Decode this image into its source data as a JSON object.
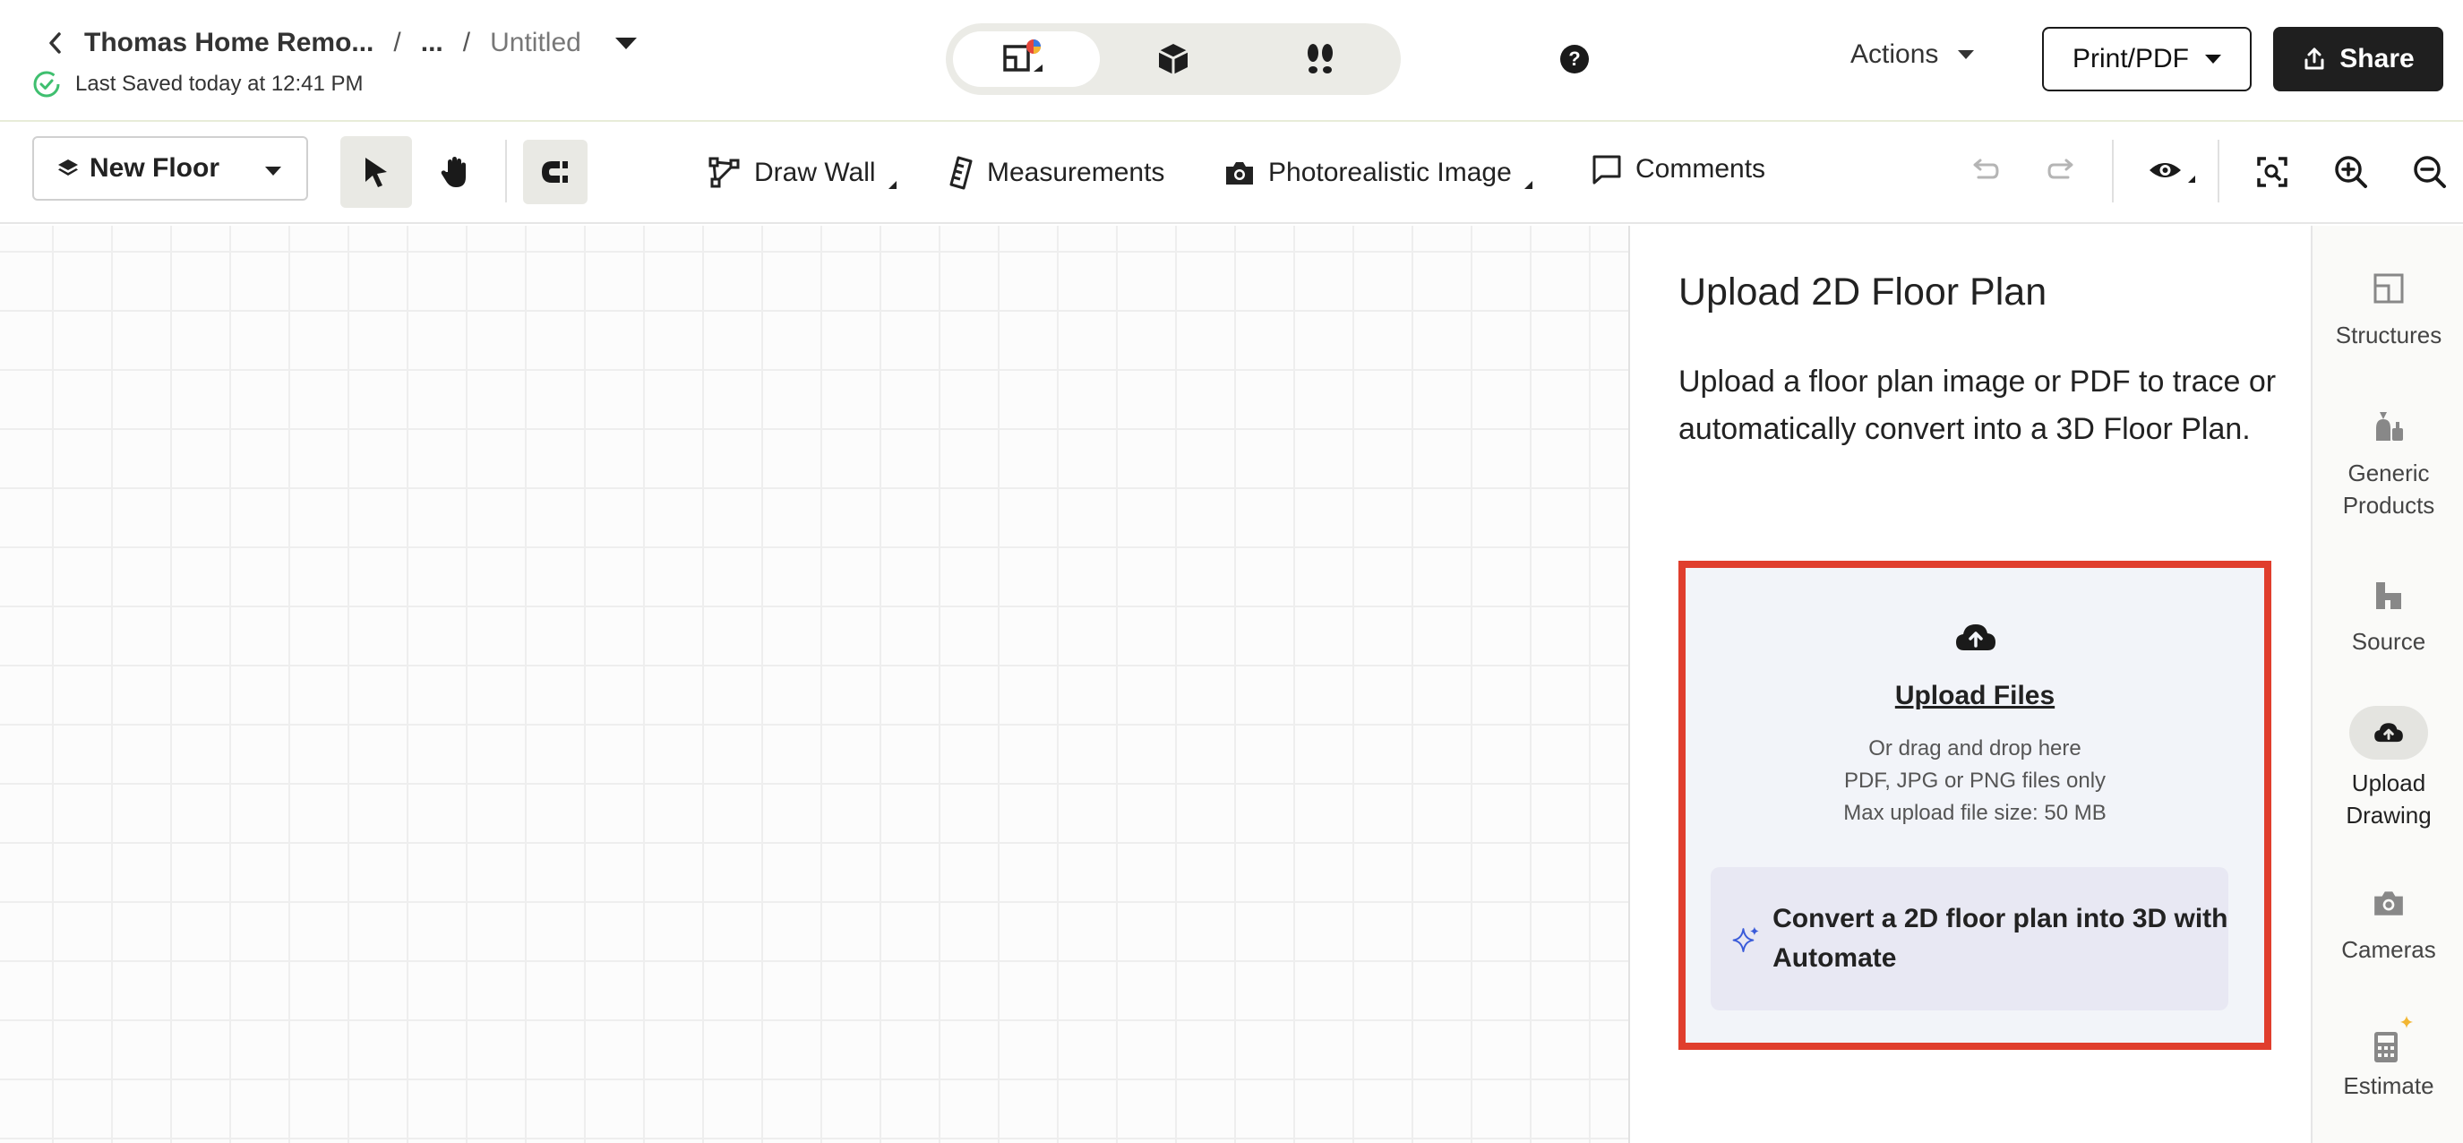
{
  "header": {
    "project": "Thomas Home Remo...",
    "separator": "/",
    "ellipsis": "...",
    "doc_title": "Untitled",
    "saved_status": "Last Saved today at 12:41 PM",
    "view_modes": [
      "2d-plan-icon",
      "3d-box-icon",
      "walkthrough-icon"
    ],
    "help_label": "?",
    "actions_label": "Actions",
    "print_label": "Print/PDF",
    "share_label": "Share"
  },
  "toolbar": {
    "floor_label": "New Floor",
    "draw_wall_label": "Draw Wall",
    "measurements_label": "Measurements",
    "photo_label": "Photorealistic Image",
    "comments_label": "Comments"
  },
  "panel": {
    "title": "Upload 2D Floor Plan",
    "description": "Upload a floor plan image or PDF to trace or automatically convert into a 3D Floor Plan.",
    "upload_link": "Upload Files",
    "drag_text": "Or drag and drop here",
    "types_text": "PDF, JPG or PNG files only",
    "size_text": "Max upload file size: 50 MB",
    "automate_text": "Convert a 2D floor plan into 3D with Automate"
  },
  "rail": {
    "structures": "Structures",
    "generic_products": "Generic Products",
    "source": "Source",
    "upload_drawing": "Upload Drawing",
    "cameras": "Cameras",
    "estimate": "Estimate"
  },
  "colors": {
    "highlight_border": "#e03e2d",
    "share_bg": "#1f1f1f",
    "saved_check": "#3fbf6f",
    "sparkle": "#3a5bd9"
  }
}
